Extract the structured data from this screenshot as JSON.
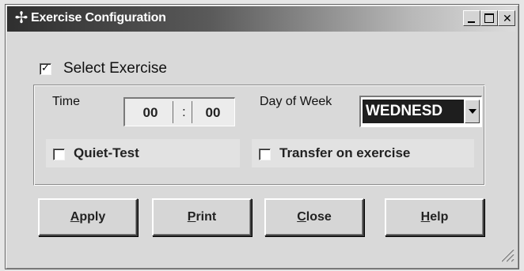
{
  "window": {
    "title": "Exercise Configuration",
    "icon": "compass-star-icon",
    "close_glyph": "✕"
  },
  "select_exercise": {
    "label": "Select Exercise",
    "checked": true,
    "check_glyph": "✓"
  },
  "time": {
    "label": "Time",
    "hours": "00",
    "separator": ":",
    "minutes": "00"
  },
  "day_of_week": {
    "label": "Day of Week",
    "value": "WEDNESD"
  },
  "quiet_test": {
    "label": "Quiet-Test",
    "checked": false
  },
  "transfer": {
    "label": "Transfer on exercise",
    "checked": false
  },
  "buttons": {
    "apply": {
      "accel": "A",
      "rest": "pply"
    },
    "print": {
      "accel": "P",
      "rest": "rint"
    },
    "close": {
      "accel": "C",
      "rest": "lose"
    },
    "help": {
      "accel": "H",
      "rest": "elp"
    }
  }
}
